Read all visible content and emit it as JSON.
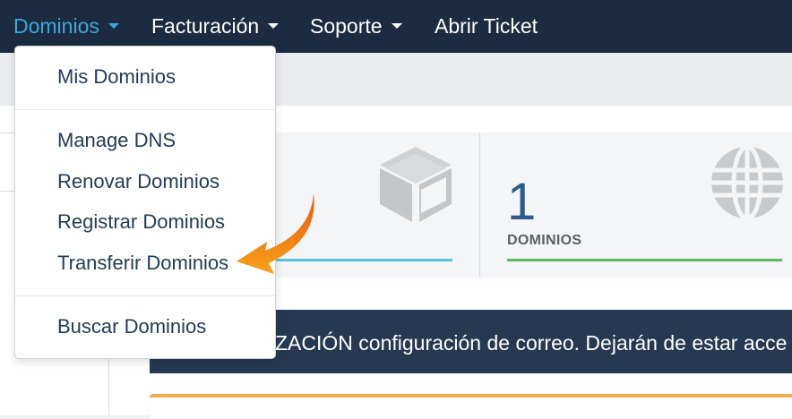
{
  "navbar": {
    "items": [
      {
        "label": "Dominios",
        "has_caret": true,
        "active": true
      },
      {
        "label": "Facturación",
        "has_caret": true,
        "active": false
      },
      {
        "label": "Soporte",
        "has_caret": true,
        "active": false
      },
      {
        "label": "Abrir Ticket",
        "has_caret": false,
        "active": false
      }
    ]
  },
  "dropdown": {
    "items": [
      {
        "label": "Mis Dominios"
      },
      {
        "label": "Manage DNS"
      },
      {
        "label": "Renovar Dominios"
      },
      {
        "label": "Registrar Dominios"
      },
      {
        "label": "Transferir Dominios",
        "highlighted_by_arrow": true
      },
      {
        "label": "Buscar Dominios"
      }
    ]
  },
  "stats": {
    "tile1": {
      "icon": "box-icon",
      "accent": "#5bc0de"
    },
    "tile2": {
      "number": "1",
      "label": "DOMINIOS",
      "icon": "globe-icon",
      "accent": "#5cb85c"
    }
  },
  "announcement": {
    "text": "ZACIÓN configuración de correo. Dejarán de estar acce"
  },
  "colors": {
    "navbar_bg": "#1b2b41",
    "active_link": "#3fa7d8",
    "announcement_bg": "#253a52",
    "arrow": "#f39c12",
    "warning_border": "#f0ad4e"
  }
}
